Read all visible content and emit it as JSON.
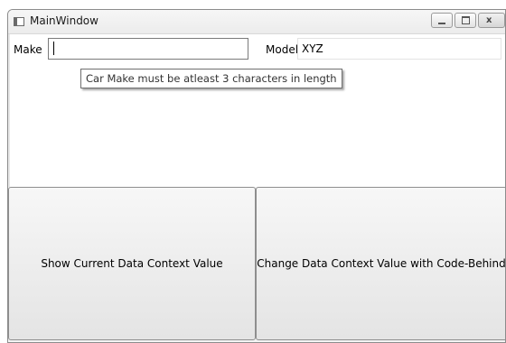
{
  "window": {
    "title": "MainWindow",
    "controls": {
      "minimize": "minimize",
      "maximize": "maximize",
      "close": "x"
    }
  },
  "form": {
    "make_label": "Make",
    "make_value": "",
    "model_label": "Model",
    "model_value": "XYZ"
  },
  "tooltip": {
    "text": "Car Make must be atleast 3 characters in length"
  },
  "buttons": {
    "show_current": "Show Current Data Context Value",
    "change_value": "Change Data Context Value with Code-Behind"
  }
}
